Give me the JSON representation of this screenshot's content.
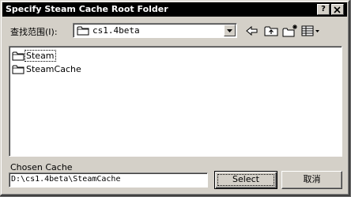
{
  "window": {
    "title": "Specify Steam Cache Root Folder",
    "help_button": "?",
    "close_button": "X"
  },
  "look_in": {
    "label": "查找范围(I):",
    "value": "cs1.4beta"
  },
  "toolbar": {
    "icons": [
      "back-icon",
      "up-folder-icon",
      "new-folder-icon",
      "view-menu-icon"
    ]
  },
  "file_list": {
    "items": [
      {
        "name": "Steam",
        "icon": "folder-icon"
      },
      {
        "name": "SteamCache",
        "icon": "folder-icon"
      }
    ]
  },
  "chosen": {
    "label": "Chosen Cache",
    "path": "D:\\cs1.4beta\\SteamCache"
  },
  "buttons": {
    "select": "Select",
    "cancel": "取消"
  }
}
